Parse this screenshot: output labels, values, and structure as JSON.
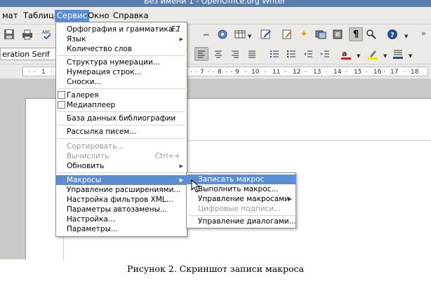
{
  "window": {
    "title": "Без имени 1 - OpenOffice.org Writer"
  },
  "menubar": {
    "items": [
      {
        "label": "мат"
      },
      {
        "label": "Таблица"
      },
      {
        "label": "Сервис"
      },
      {
        "label": "Окно"
      },
      {
        "label": "Справка"
      }
    ]
  },
  "toolbar": {
    "font_name": "eration Serif",
    "icons": [
      "floppy-icon",
      "printer-icon",
      "spellcheck-icon",
      "redo-icon",
      "navigator-icon",
      "table-icon",
      "draw-icon",
      "edit-icon",
      "star-icon",
      "gallery-icon",
      "datasource-icon",
      "formatting-marks-icon",
      "zoom-icon",
      "help-icon",
      "align-left-icon",
      "align-center-icon",
      "align-right-icon",
      "justify-icon",
      "numbering-icon",
      "bullets-icon",
      "decrease-indent-icon",
      "increase-indent-icon",
      "font-color-icon",
      "highlight-icon",
      "background-color-icon"
    ]
  },
  "ruler": {
    "numbers": [
      "1",
      "7",
      "8",
      "9",
      "10",
      "11",
      "12",
      "13",
      "14",
      "15",
      "16",
      "17",
      "18"
    ]
  },
  "service_menu": {
    "items": [
      {
        "label": "Орфография и грамматика...",
        "shortcut": "F7"
      },
      {
        "label": "Язык"
      },
      {
        "label": "Количество слов"
      },
      {
        "label": "Структура нумерации..."
      },
      {
        "label": "Нумерация строк..."
      },
      {
        "label": "Сноски..."
      },
      {
        "label": "Галерея"
      },
      {
        "label": "Медиаплеер"
      },
      {
        "label": "База данных библиографии"
      },
      {
        "label": "Рассылка писем..."
      },
      {
        "label": "Сортировать..."
      },
      {
        "label": "Вычислить",
        "shortcut": "Ctrl++"
      },
      {
        "label": "Обновить"
      },
      {
        "label": "Макросы"
      },
      {
        "label": "Управление расширениями..."
      },
      {
        "label": "Настройка фильтров XML..."
      },
      {
        "label": "Параметры автозамены..."
      },
      {
        "label": "Настройка..."
      },
      {
        "label": "Параметры..."
      }
    ]
  },
  "macro_submenu": {
    "items": [
      {
        "label": "Записать макрос"
      },
      {
        "label": "Выполнить макрос..."
      },
      {
        "label": "Управление макросами"
      },
      {
        "label": "Цифровые подписи..."
      },
      {
        "label": "Управление диалогами..."
      }
    ]
  },
  "caption": "Рисунок 2. Скриншот записи макроса",
  "colors": {
    "highlight": "#5c8dd2",
    "menubar_bg": "#ebeae7",
    "doc_bg": "#c9c8c5"
  }
}
